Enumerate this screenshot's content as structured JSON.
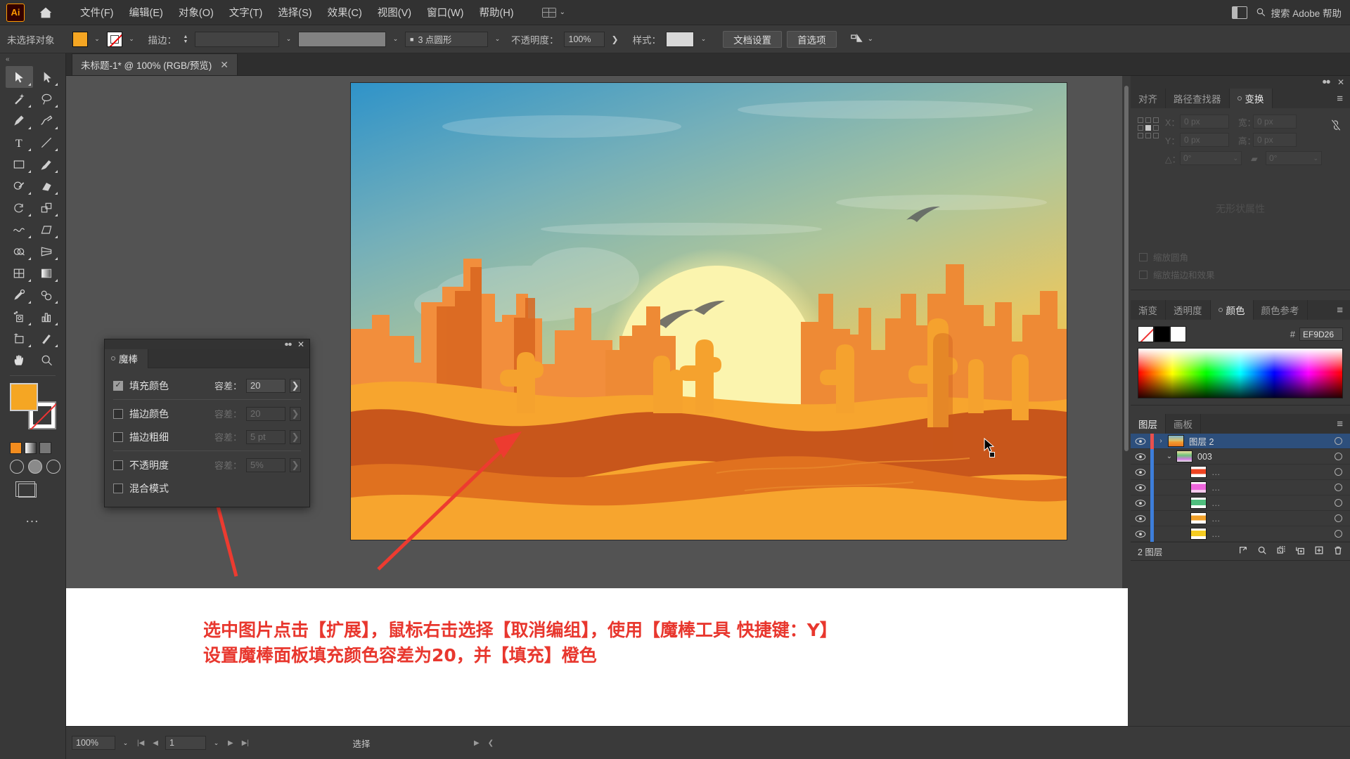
{
  "app": {
    "name": "Adobe Illustrator",
    "logo_text": "Ai",
    "home_icon": "home-icon"
  },
  "menubar": {
    "items": [
      {
        "label": "文件(F)"
      },
      {
        "label": "编辑(E)"
      },
      {
        "label": "对象(O)"
      },
      {
        "label": "文字(T)"
      },
      {
        "label": "选择(S)"
      },
      {
        "label": "效果(C)"
      },
      {
        "label": "视图(V)"
      },
      {
        "label": "窗口(W)"
      },
      {
        "label": "帮助(H)"
      }
    ],
    "workspace_caret": "⌄",
    "search_placeholder": "搜索 Adobe 帮助"
  },
  "controlbar": {
    "selection_status": "未选择对象",
    "fill_color": "#F5A623",
    "stroke_color": "#FFFFFF",
    "stroke_label": "描边：",
    "stroke_weight": "",
    "stroke_profile": "",
    "brush_definition": "3 点圆形",
    "opacity_label": "不透明度：",
    "opacity_value": "100%",
    "style_label": "样式：",
    "doc_setup_button": "文档设置",
    "preferences_button": "首选项",
    "align_icon": "align-icon"
  },
  "document_tab": {
    "title": "未标题-1* @ 100% (RGB/预览)",
    "close_icon": "close-icon"
  },
  "toolbar": {
    "handle": "«",
    "tools": [
      {
        "name": "selection-tool",
        "selected": true
      },
      {
        "name": "direct-selection-tool",
        "selected": false
      },
      {
        "name": "magic-wand-tool",
        "selected": false
      },
      {
        "name": "lasso-tool",
        "selected": false
      },
      {
        "name": "pen-tool",
        "selected": false
      },
      {
        "name": "curvature-tool",
        "selected": false
      },
      {
        "name": "type-tool",
        "selected": false
      },
      {
        "name": "line-segment-tool",
        "selected": false
      },
      {
        "name": "rectangle-tool",
        "selected": false
      },
      {
        "name": "paintbrush-tool",
        "selected": false
      },
      {
        "name": "shaper-tool",
        "selected": false
      },
      {
        "name": "eraser-tool",
        "selected": false
      },
      {
        "name": "rotate-tool",
        "selected": false
      },
      {
        "name": "scale-tool",
        "selected": false
      },
      {
        "name": "width-tool",
        "selected": false
      },
      {
        "name": "free-transform-tool",
        "selected": false
      },
      {
        "name": "shape-builder-tool",
        "selected": false
      },
      {
        "name": "perspective-grid-tool",
        "selected": false
      },
      {
        "name": "mesh-tool",
        "selected": false
      },
      {
        "name": "gradient-tool",
        "selected": false
      },
      {
        "name": "eyedropper-tool",
        "selected": false
      },
      {
        "name": "blend-tool",
        "selected": false
      },
      {
        "name": "symbol-sprayer-tool",
        "selected": false
      },
      {
        "name": "column-graph-tool",
        "selected": false
      },
      {
        "name": "artboard-tool",
        "selected": false
      },
      {
        "name": "slice-tool",
        "selected": false
      },
      {
        "name": "hand-tool",
        "selected": false
      },
      {
        "name": "zoom-tool",
        "selected": false
      }
    ],
    "fill_swatch": "#F5A623",
    "stroke_swatch": "#FFFFFF",
    "more_options": "…"
  },
  "magic_wand_panel": {
    "tab_label": "魔棒",
    "close_icon": "close-icon",
    "collapse_icon": "collapse-icon",
    "rows": [
      {
        "label": "填充颜色",
        "checked": true,
        "tolerance_label": "容差：",
        "tolerance_value": "20",
        "enabled": true
      },
      {
        "label": "描边颜色",
        "checked": false,
        "tolerance_label": "容差：",
        "tolerance_value": "20",
        "enabled": false
      },
      {
        "label": "描边粗细",
        "checked": false,
        "tolerance_label": "容差：",
        "tolerance_value": "5 pt",
        "enabled": false
      },
      {
        "label": "不透明度",
        "checked": false,
        "tolerance_label": "容差：",
        "tolerance_value": "5%",
        "enabled": false
      },
      {
        "label": "混合模式",
        "checked": false,
        "tolerance_label": "",
        "tolerance_value": "",
        "enabled": false
      }
    ]
  },
  "transform_panel": {
    "tabs": [
      {
        "label": "对齐",
        "active": false
      },
      {
        "label": "路径查找器",
        "active": false
      },
      {
        "label": "变换",
        "active": true
      }
    ],
    "menu_icon": "panel-menu-icon",
    "close_icon": "close-icon",
    "fields": {
      "x_label": "X：",
      "x_value": "0 px",
      "y_label": "Y：",
      "y_value": "0 px",
      "w_label": "宽：",
      "w_value": "0 px",
      "h_label": "高：",
      "h_value": "0 px",
      "angle_label": "△：",
      "angle_value": "0°",
      "shear_label": "shear",
      "shear_value": "0°"
    },
    "link_icon": "link-broken-icon",
    "empty_text": "无形状属性",
    "checkboxes": [
      {
        "label": "缩放圆角"
      },
      {
        "label": "缩放描边和效果"
      }
    ]
  },
  "color_panel": {
    "tabs": [
      {
        "label": "渐变",
        "active": false
      },
      {
        "label": "透明度",
        "active": false
      },
      {
        "label": "颜色",
        "active": true
      },
      {
        "label": "颜色参考",
        "active": false
      }
    ],
    "menu_icon": "panel-menu-icon",
    "hex_prefix": "#",
    "hex_value": "EF9D26",
    "swatches": [
      "none",
      "#000000",
      "#FFFFFF"
    ]
  },
  "layers_panel": {
    "tabs": [
      {
        "label": "图层",
        "active": true
      },
      {
        "label": "画板",
        "active": false
      }
    ],
    "menu_icon": "panel-menu-icon",
    "rows": [
      {
        "name": "图层 2",
        "selected": true,
        "indent": 0,
        "color": "#E8504E",
        "thumb": "sunset-thumb",
        "twisty": "›",
        "eye": "eye-icon"
      },
      {
        "name": "003",
        "selected": false,
        "indent": 1,
        "color": "#3D7EDB",
        "thumb": "art-thumb",
        "twisty": "⌄",
        "eye": "eye-icon"
      },
      {
        "name": "…",
        "selected": false,
        "indent": 2,
        "color": "#3D7EDB",
        "thumb": "#EE4422",
        "twisty": "",
        "eye": "eye-icon"
      },
      {
        "name": "…",
        "selected": false,
        "indent": 2,
        "color": "#3D7EDB",
        "thumb": "#EE66DD",
        "twisty": "",
        "eye": "eye-icon"
      },
      {
        "name": "…",
        "selected": false,
        "indent": 2,
        "color": "#3D7EDB",
        "thumb": "#4FBE7E",
        "twisty": "",
        "eye": "eye-icon"
      },
      {
        "name": "…",
        "selected": false,
        "indent": 2,
        "color": "#3D7EDB",
        "thumb": "#F0A029",
        "twisty": "",
        "eye": "eye-icon"
      },
      {
        "name": "…",
        "selected": false,
        "indent": 2,
        "color": "#3D7EDB",
        "thumb": "#F5CC22",
        "twisty": "",
        "eye": "eye-icon"
      }
    ],
    "footer_count": "2 图层",
    "footer_icons": [
      "locate-object-icon",
      "search-icon",
      "new-sublayer-icon",
      "new-layer-icon",
      "make-clipping-mask-icon",
      "delete-layer-icon"
    ]
  },
  "annotation": {
    "line1": "选中图片点击【扩展】，鼠标右击选择【取消编组】，使用【魔棒工具 快捷键：Y】",
    "line2": "设置魔棒面板填充颜色容差为20，并【填充】橙色",
    "color": "#E8372E",
    "arrows": 2
  },
  "statusbar": {
    "zoom": "100%",
    "page": "1",
    "status_text": "选择",
    "first_icon": "first-page-icon",
    "prev_icon": "prev-page-icon",
    "next_icon": "next-page-icon",
    "last_icon": "last-page-icon"
  },
  "artwork": {
    "description": "沙漠日落矢量插画",
    "sky_top": "#3D9BC9",
    "sky_mid": "#9FC3A8",
    "sky_bottom": "#F2C246",
    "sun": "#FAF2A8",
    "mesa_dark": "#D4661F",
    "mesa_light": "#F2903A",
    "sand": "#F7A52E",
    "dune_dark": "#C8581B",
    "cactus": "#F5A22E",
    "birds": 2
  }
}
